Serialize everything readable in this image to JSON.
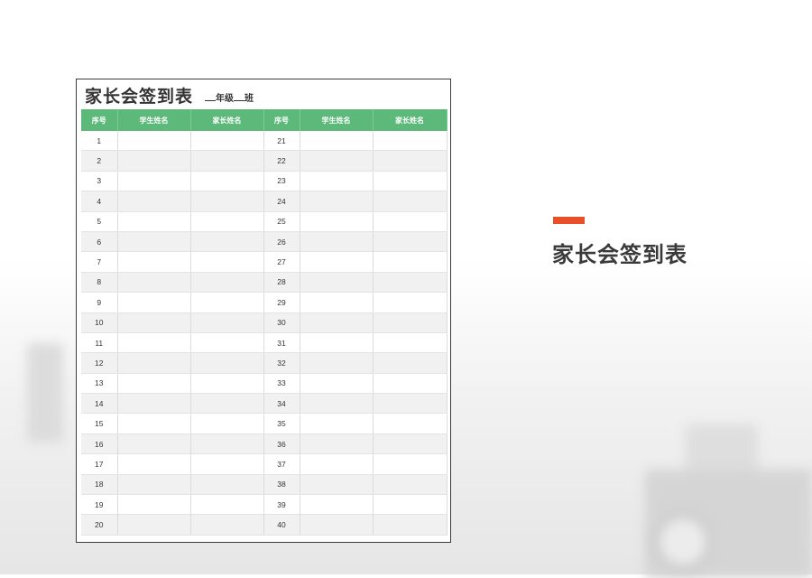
{
  "sheet": {
    "title": "家长会签到表",
    "grade_label": "年级",
    "class_label": "班",
    "headers": [
      "序号",
      "学生姓名",
      "家长姓名",
      "序号",
      "学生姓名",
      "家长姓名"
    ],
    "left_numbers": [
      "1",
      "2",
      "3",
      "4",
      "5",
      "6",
      "7",
      "8",
      "9",
      "10",
      "11",
      "12",
      "13",
      "14",
      "15",
      "16",
      "17",
      "18",
      "19",
      "20"
    ],
    "right_numbers": [
      "21",
      "22",
      "23",
      "24",
      "25",
      "26",
      "27",
      "28",
      "29",
      "30",
      "31",
      "32",
      "33",
      "34",
      "35",
      "36",
      "37",
      "38",
      "39",
      "40"
    ]
  },
  "right_panel": {
    "accent_color": "#e8502a",
    "title": "家长会签到表"
  },
  "colors": {
    "header_green": "#5cb97a"
  }
}
